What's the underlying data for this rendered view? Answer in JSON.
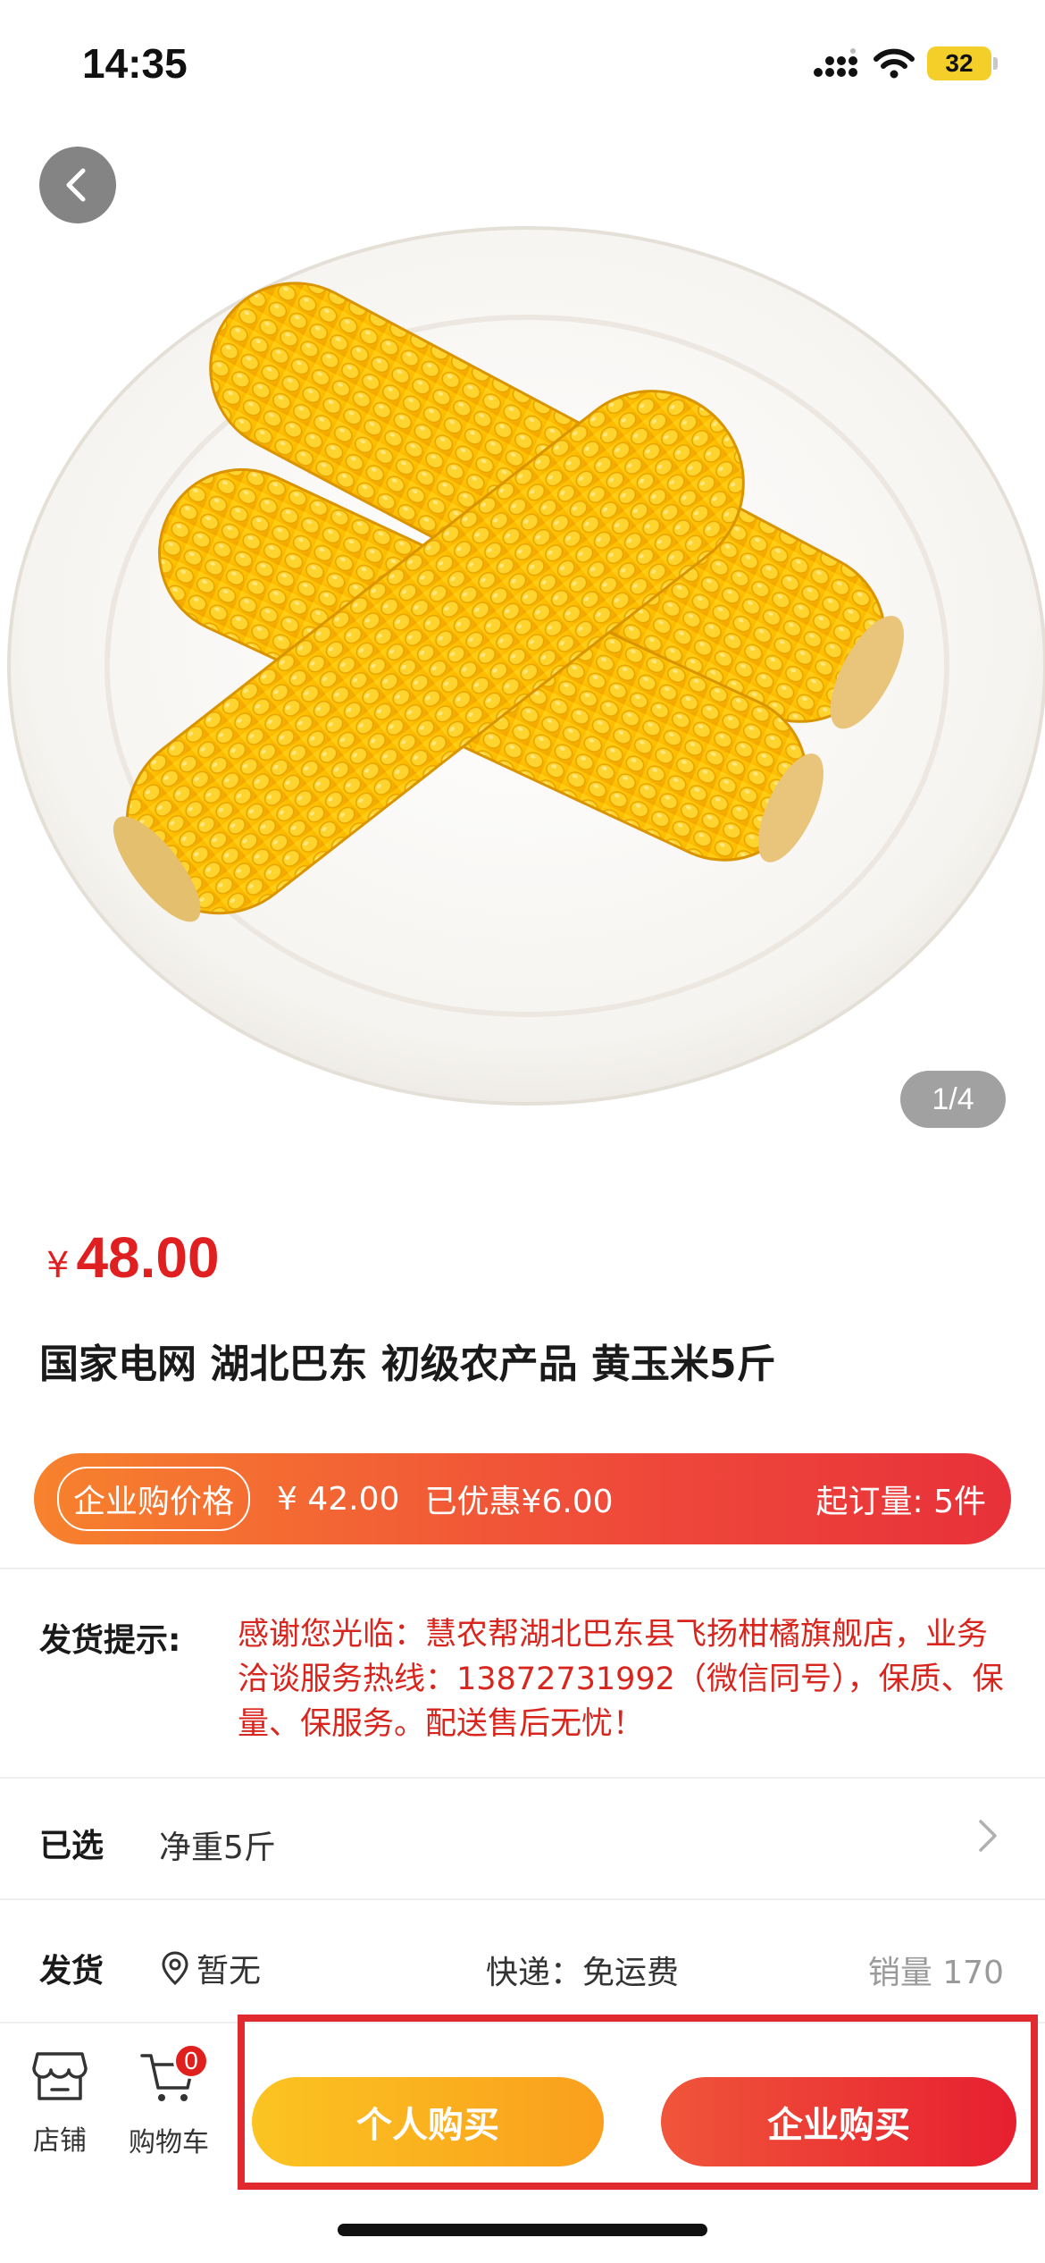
{
  "status_bar": {
    "time": "14:35",
    "battery": "32",
    "signal_icon": "signal-icon",
    "wifi_icon": "wifi-icon"
  },
  "hero": {
    "page_indicator": "1/4",
    "back_icon": "chevron-left-icon"
  },
  "product": {
    "currency": "¥",
    "price": "48.00",
    "title": "国家电网 湖北巴东 初级农产品 黄玉米5斤"
  },
  "enterprise_banner": {
    "tag": "企业购价格",
    "price": "¥ 42.00",
    "discount": "已优惠¥6.00",
    "moq": "起订量: 5件"
  },
  "delivery_tip": {
    "label": "发货提示:",
    "text": "感谢您光临：慧农帮湖北巴东县飞扬柑橘旗舰店，业务洽谈服务热线：13872731992（微信同号），保质、保量、保服务。配送售后无忧！"
  },
  "selected": {
    "label": "已选",
    "value": "净重5斤"
  },
  "shipping": {
    "label": "发货",
    "location": "暂无",
    "express": "快递：免运费",
    "sales": "销量 170"
  },
  "bottom_bar": {
    "store_label": "店铺",
    "cart_label": "购物车",
    "cart_count": "0",
    "personal_buy": "个人购买",
    "enterprise_buy": "企业购买"
  },
  "colors": {
    "price_red": "#e02020",
    "tip_red": "#d8261e",
    "banner_start": "#f7822d",
    "banner_end": "#e8313a",
    "personal_start": "#fbc421",
    "personal_end": "#fa9f1d",
    "enterprise_start": "#f0553a",
    "enterprise_end": "#e71f30",
    "highlight": "#e02a2f"
  }
}
